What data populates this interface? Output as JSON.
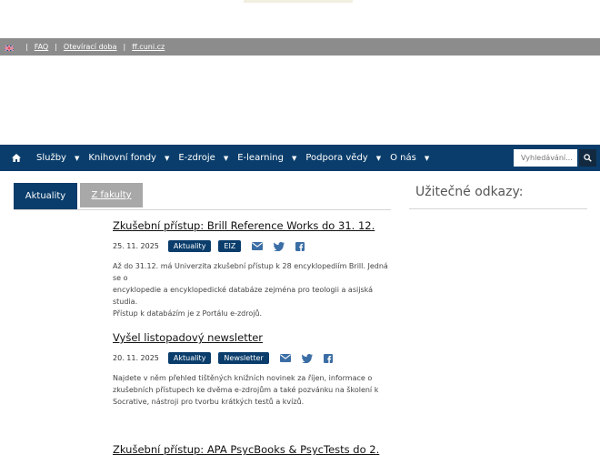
{
  "topbar": {
    "language": "English",
    "links": [
      "FAQ",
      "Otevírací doba",
      "ff.cuni.cz"
    ]
  },
  "nav": {
    "items": [
      {
        "label": "Služby"
      },
      {
        "label": "Knihovní fondy"
      },
      {
        "label": "E-zdroje"
      },
      {
        "label": "E-learning"
      },
      {
        "label": "Podpora vědy"
      },
      {
        "label": "O nás"
      }
    ],
    "search_placeholder": "Vyhledávání..."
  },
  "tabs": {
    "active": "Aktuality",
    "inactive": "Z fakulty"
  },
  "sidebar": {
    "title": "Užitečné odkazy:"
  },
  "articles": [
    {
      "title": "Zkušební přístup: Brill Reference Works do 31. 12.",
      "date": "25. 11. 2025",
      "tags": [
        "Aktuality",
        "EIZ"
      ],
      "lines": [
        "Až do 31.12. má Univerzita zkušební přístup k 28 encyklopediím Brill. Jedná se o",
        "encyklopedie a encyklopedické databáze zejména pro teologii a asijská studia.",
        "Přístup k databázím je z Portálu e-zdrojů."
      ]
    },
    {
      "title": "Vyšel listopadový newsletter",
      "date": "20. 11. 2025",
      "tags": [
        "Aktuality",
        "Newsletter"
      ],
      "lines": [
        "Najdete v něm přehled tištěných knižních novinek za říjen, informace o",
        "zkušebních přístupech ke dvěma e-zdrojům a také pozvánku na školení k",
        "Socrative, nástroji pro tvorbu krátkých testů a kvízů."
      ]
    },
    {
      "title": "Zkušební přístup: APA PsycBooks & PsycTests do 2."
    }
  ],
  "colors": {
    "nav": "#0a3d6b",
    "topbar": "#8c8c8c",
    "tab_inactive": "#a8a8a8"
  }
}
